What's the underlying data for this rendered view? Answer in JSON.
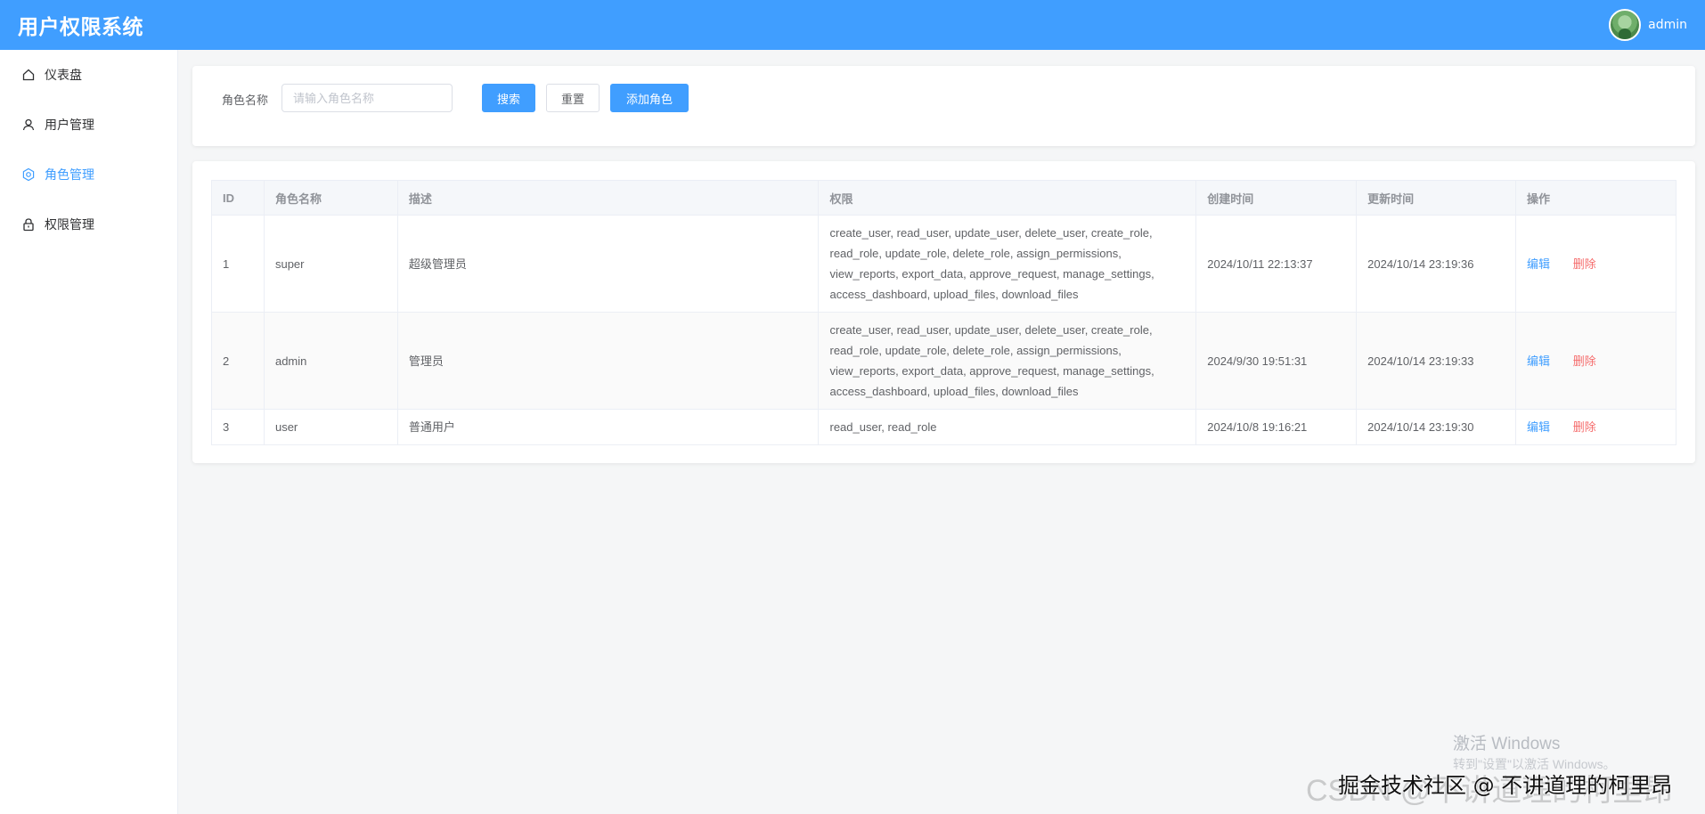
{
  "header": {
    "app_title": "用户权限系统",
    "username": "admin"
  },
  "sidebar": {
    "items": [
      {
        "label": "仪表盘",
        "icon": "home-icon",
        "active": false
      },
      {
        "label": "用户管理",
        "icon": "user-icon",
        "active": false
      },
      {
        "label": "角色管理",
        "icon": "gear-icon",
        "active": true
      },
      {
        "label": "权限管理",
        "icon": "lock-icon",
        "active": false
      }
    ]
  },
  "search": {
    "label": "角色名称",
    "placeholder": "请输入角色名称",
    "value": "",
    "search_button": "搜索",
    "reset_button": "重置",
    "add_button": "添加角色"
  },
  "table": {
    "columns": [
      "ID",
      "角色名称",
      "描述",
      "权限",
      "创建时间",
      "更新时间",
      "操作"
    ],
    "rows": [
      {
        "id": "1",
        "name": "super",
        "description": "超级管理员",
        "permissions": "create_user, read_user, update_user, delete_user, create_role, read_role, update_role, delete_role, assign_permissions, view_reports, export_data, approve_request, manage_settings, access_dashboard, upload_files, download_files",
        "created": "2024/10/11 22:13:37",
        "updated": "2024/10/14 23:19:36",
        "edit": "编辑",
        "delete": "删除"
      },
      {
        "id": "2",
        "name": "admin",
        "description": "管理员",
        "permissions": "create_user, read_user, update_user, delete_user, create_role, read_role, update_role, delete_role, assign_permissions, view_reports, export_data, approve_request, manage_settings, access_dashboard, upload_files, download_files",
        "created": "2024/9/30 19:51:31",
        "updated": "2024/10/14 23:19:33",
        "edit": "编辑",
        "delete": "删除"
      },
      {
        "id": "3",
        "name": "user",
        "description": "普通用户",
        "permissions": "read_user, read_role",
        "created": "2024/10/8 19:16:21",
        "updated": "2024/10/14 23:19:30",
        "edit": "编辑",
        "delete": "删除"
      }
    ]
  },
  "watermarks": {
    "windows_title": "激活 Windows",
    "windows_sub": "转到\"设置\"以激活 Windows。",
    "csdn": "CSDN @不讲道理的柯里昂",
    "juejin": "掘金技术社区 @ 不讲道理的柯里昂"
  },
  "colors": {
    "primary": "#409eff",
    "danger": "#f56c6c",
    "background": "#f5f6f7"
  }
}
